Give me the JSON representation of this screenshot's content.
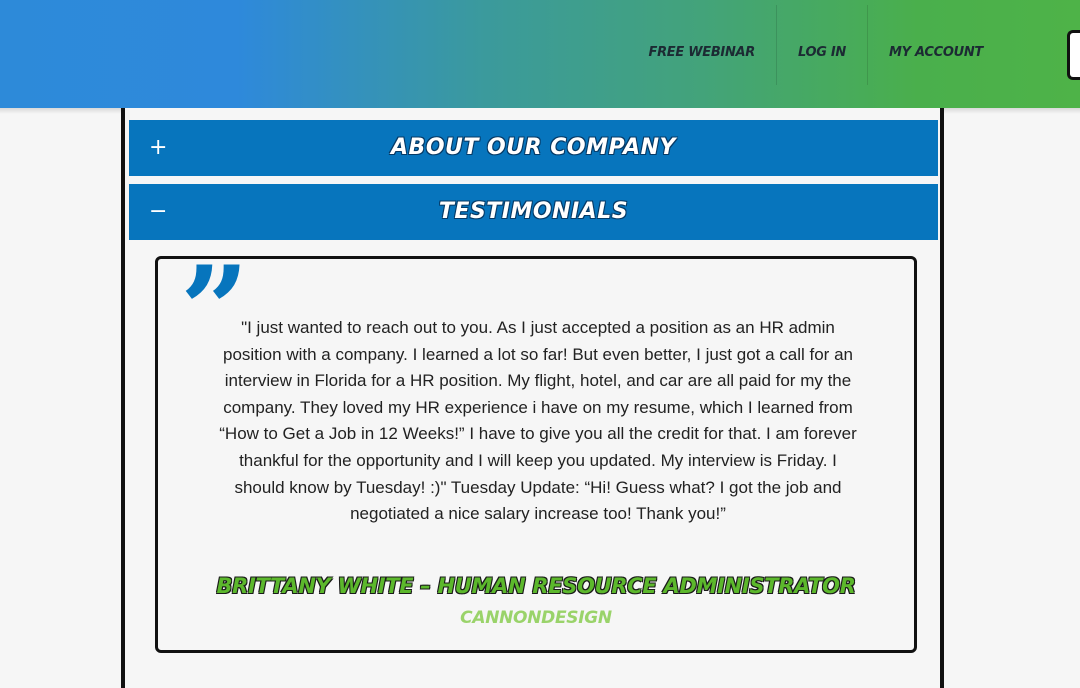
{
  "header": {
    "nav": [
      "Free Webinar",
      "Log In",
      "My Account"
    ],
    "gradient": [
      "#2d8ad9",
      "#4eb348"
    ]
  },
  "accordion": {
    "items": [
      {
        "sign": "+",
        "title": "About Our Company",
        "expanded": false
      },
      {
        "sign": "−",
        "title": "Testimonials",
        "expanded": true
      }
    ],
    "color": "#0775bd"
  },
  "testimonial": {
    "quote_icon": "closing-quote-icon",
    "text": "\"I just wanted to reach out to you. As I just accepted a position as an HR admin position with a company. I learned a lot so far! But even better, I just got a call for an interview in Florida for a HR position. My flight, hotel, and car are all paid for my the company. They loved my HR experience i have on my resume, which I learned from “How to Get a Job in 12 Weeks!” I have to give you all the credit for that. I am forever thankful for the opportunity and I will keep you updated. My interview is Friday. I should know by Tuesday! :)\" Tuesday Update: “Hi! Guess what? I got the job and negotiated a nice salary increase too! Thank you!”",
    "author": "Brittany White – Human Resource Administrator",
    "company": "CannonDesign",
    "author_color": "#5cb82c",
    "company_color": "#9ad36a"
  }
}
